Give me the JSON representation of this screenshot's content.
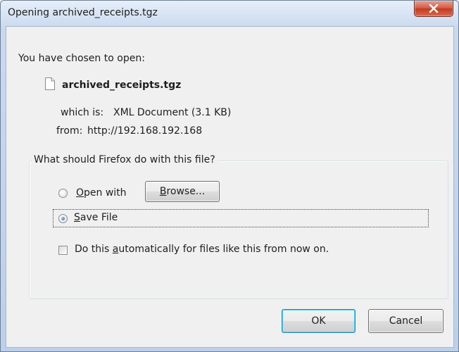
{
  "window": {
    "title": "Opening archived_receipts.tgz",
    "close_icon": "close-icon"
  },
  "intro": "You have chosen to open:",
  "file": {
    "icon": "file-icon",
    "name": "archived_receipts.tgz",
    "which_label": "which is:",
    "which_value": "XML Document (3.1 KB)",
    "from_label": "from:",
    "from_value": "http://192.168.192.168"
  },
  "group": {
    "legend": "What should Firefox do with this file?",
    "open_with_prefix": "",
    "open_with_accel": "O",
    "open_with_rest": "pen with",
    "browse_accel": "B",
    "browse_rest": "rowse...",
    "save_accel": "S",
    "save_rest": "ave File",
    "auto_pre": "Do this ",
    "auto_accel": "a",
    "auto_post": "utomatically for files like this from now on.",
    "selected_option": "save"
  },
  "buttons": {
    "ok": "OK",
    "cancel": "Cancel"
  }
}
